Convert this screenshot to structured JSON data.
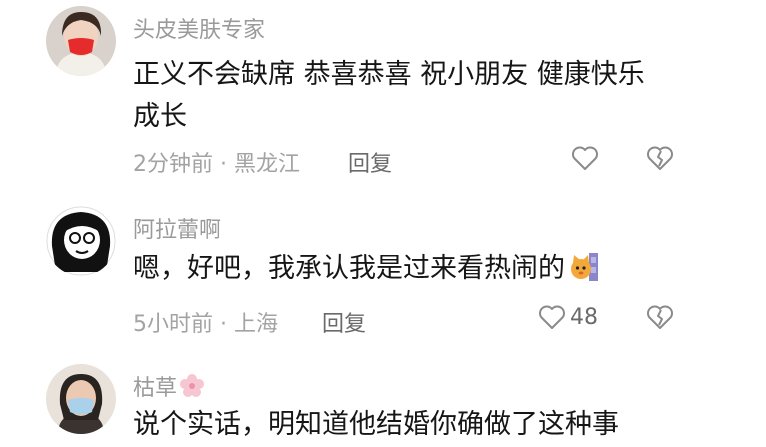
{
  "comments": [
    {
      "username": "头皮美肤专家",
      "text_line1": "正义不会缺席 恭喜恭喜 祝小朋友 健康快乐",
      "text_line2": "成长",
      "meta": "2分钟前 · 黑龙江",
      "reply_label": "回复",
      "like_count": ""
    },
    {
      "username": "阿拉蕾啊",
      "text": "嗯，好吧，我承认我是过来看热闹的",
      "meta": "5小时前 · 上海",
      "reply_label": "回复",
      "like_count": "48"
    },
    {
      "username": "枯草",
      "text": "说个实话，明知道他结婚你确做了这种事"
    }
  ],
  "icons": {
    "like": "heart-outline-icon",
    "dislike": "broken-heart-icon"
  },
  "colors": {
    "text": "#161616",
    "muted": "#9a9a9a",
    "icon": "#8a8a8a"
  }
}
